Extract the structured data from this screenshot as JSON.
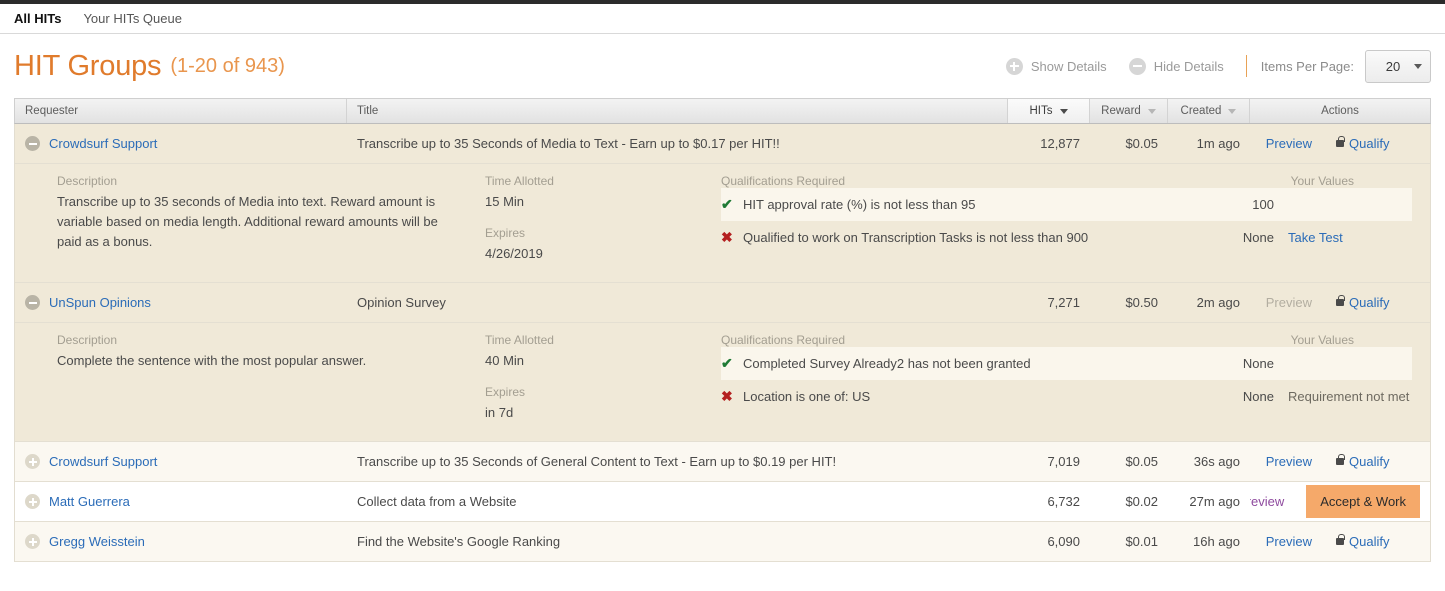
{
  "tabs": [
    {
      "label": "All HITs",
      "active": true
    },
    {
      "label": "Your HITs Queue",
      "active": false
    }
  ],
  "header": {
    "title": "HIT Groups",
    "count": "(1-20 of 943)",
    "show_details": "Show Details",
    "hide_details": "Hide Details",
    "items_per_page_label": "Items Per Page:",
    "items_per_page_value": "20",
    "accent_color": "#e07b2c",
    "show_details_icon": "plus-circle-icon",
    "hide_details_icon": "minus-circle-icon"
  },
  "columns": {
    "requester": "Requester",
    "title": "Title",
    "hits": "HITs",
    "reward": "Reward",
    "created": "Created",
    "actions": "Actions"
  },
  "detail_labels": {
    "description": "Description",
    "time_allotted": "Time Allotted",
    "expires": "Expires",
    "qualifications": "Qualifications Required",
    "your_values": "Your Values"
  },
  "rows": [
    {
      "requester": "Crowdsurf Support",
      "title": "Transcribe up to 35 Seconds of Media to Text - Earn up to $0.17 per HIT!!",
      "hits": "12,877",
      "reward": "$0.05",
      "created": "1m ago",
      "preview": "Preview",
      "qualify": "Qualify",
      "expanded": true,
      "detail": {
        "description": "Transcribe up to 35 seconds of Media into text. Reward amount is variable based on media length. Additional reward amounts will be paid as a bonus.",
        "time_allotted": "15 Min",
        "expires": "4/26/2019",
        "qualifications": [
          {
            "status": "met",
            "text": "HIT approval rate (%) is not less than 95",
            "value": "100",
            "action": ""
          },
          {
            "status": "unmet",
            "text": "Qualified to work on Transcription Tasks is not less than 900",
            "value": "None",
            "action": "Take Test"
          }
        ]
      }
    },
    {
      "requester": "UnSpun Opinions",
      "title": "Opinion Survey",
      "hits": "7,271",
      "reward": "$0.50",
      "created": "2m ago",
      "preview": "Preview",
      "qualify": "Qualify",
      "expanded": true,
      "detail": {
        "description": "Complete the sentence with the most popular answer.",
        "time_allotted": "40 Min",
        "expires": "in 7d",
        "qualifications": [
          {
            "status": "met",
            "text": "Completed Survey Already2 has not been granted",
            "value": "None",
            "action": ""
          },
          {
            "status": "unmet",
            "text": "Location is one of: US",
            "value": "None",
            "action": "Requirement not met"
          }
        ]
      }
    },
    {
      "requester": "Crowdsurf Support",
      "title": "Transcribe up to 35 Seconds of General Content to Text - Earn up to $0.19 per HIT!",
      "hits": "7,019",
      "reward": "$0.05",
      "created": "36s ago",
      "preview": "Preview",
      "qualify": "Qualify",
      "expanded": false
    },
    {
      "requester": "Matt Guerrera",
      "title": "Collect data from a Website",
      "hits": "6,732",
      "reward": "$0.02",
      "created": "27m ago",
      "preview": "Preview",
      "accept": "Accept & Work",
      "expanded": false
    },
    {
      "requester": "Gregg Weisstein",
      "title": "Find the Website's Google Ranking",
      "hits": "6,090",
      "reward": "$0.01",
      "created": "16h ago",
      "preview": "Preview",
      "qualify": "Qualify",
      "expanded": false
    }
  ]
}
